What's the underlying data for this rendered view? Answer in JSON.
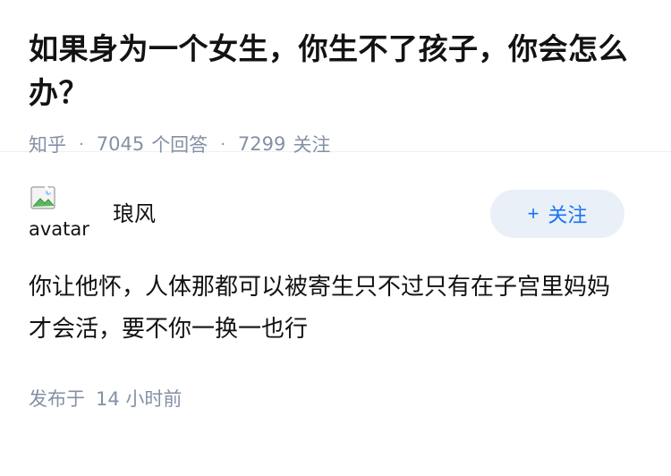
{
  "question": {
    "title": "如果身为一个女生，你生不了孩子，你会怎么办？",
    "source": "知乎",
    "answer_count": "7045",
    "answer_label": "个回答",
    "follower_count": "7299",
    "follower_label": "关注",
    "separator": "·"
  },
  "answer": {
    "author": {
      "name": "琅风",
      "avatar_alt": "avatar",
      "avatar_icon": "broken-image-icon"
    },
    "follow_button": {
      "icon": "+",
      "label": "关注"
    },
    "content": "你让他怀，人体那都可以被寄生只不过只有在子宫里妈妈才会活，要不你一换一也行",
    "time": {
      "prefix": "发布于",
      "value": "14 小时前"
    }
  },
  "colors": {
    "meta": "#8590a6",
    "accent": "#1772f6",
    "follow_bg": "#e9f0f8",
    "text": "#121212"
  }
}
